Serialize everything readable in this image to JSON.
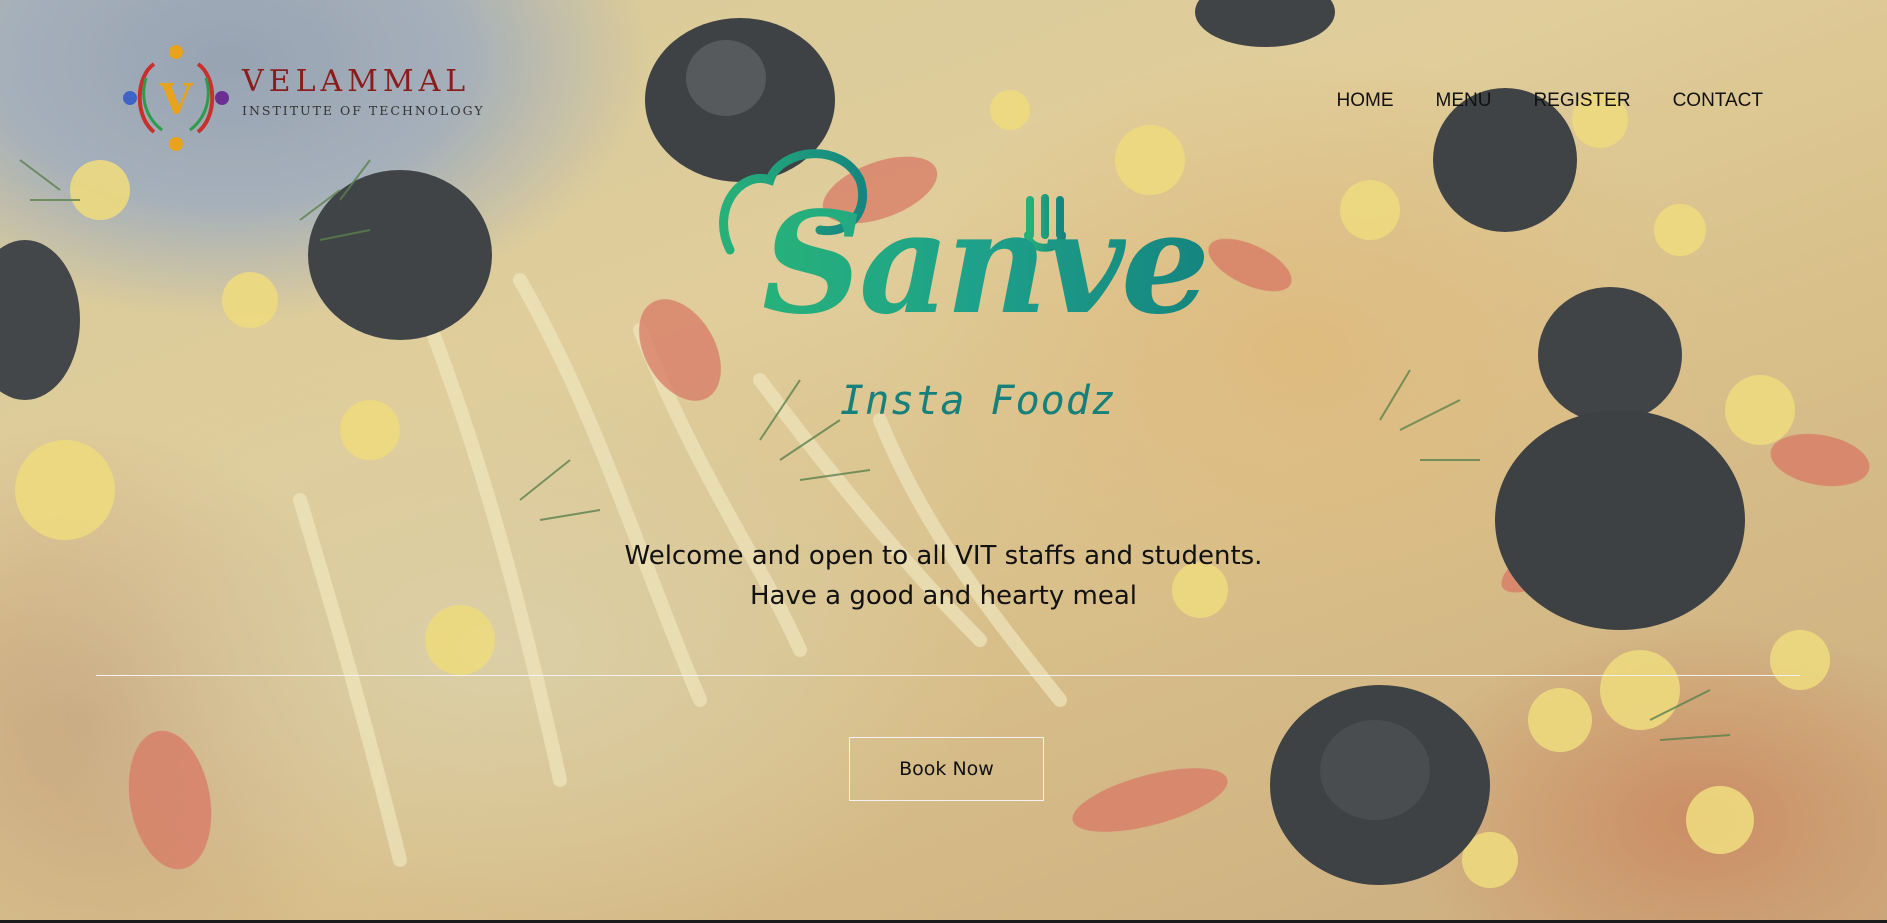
{
  "header": {
    "logo": {
      "name": "VELAMMAL",
      "subtitle": "INSTITUTE OF TECHNOLOGY",
      "emblem_letter": "V",
      "emblem_icon": "people-circle-logo-icon"
    },
    "nav": [
      {
        "label": "HOME"
      },
      {
        "label": "MENU"
      },
      {
        "label": "REGISTER"
      },
      {
        "label": "CONTACT"
      }
    ]
  },
  "hero": {
    "brand_name": "Sanve",
    "brand_tagline": "Insta Foodz",
    "welcome_line1": "Welcome and open to all VIT staffs and students.",
    "welcome_line2": "Have a good and hearty meal",
    "cta_label": "Book Now"
  },
  "colors": {
    "brand_green": "#27b17a",
    "brand_teal": "#15857f",
    "logo_maroon": "#8b1c1c",
    "background_overlay": "#d7e1e1"
  }
}
